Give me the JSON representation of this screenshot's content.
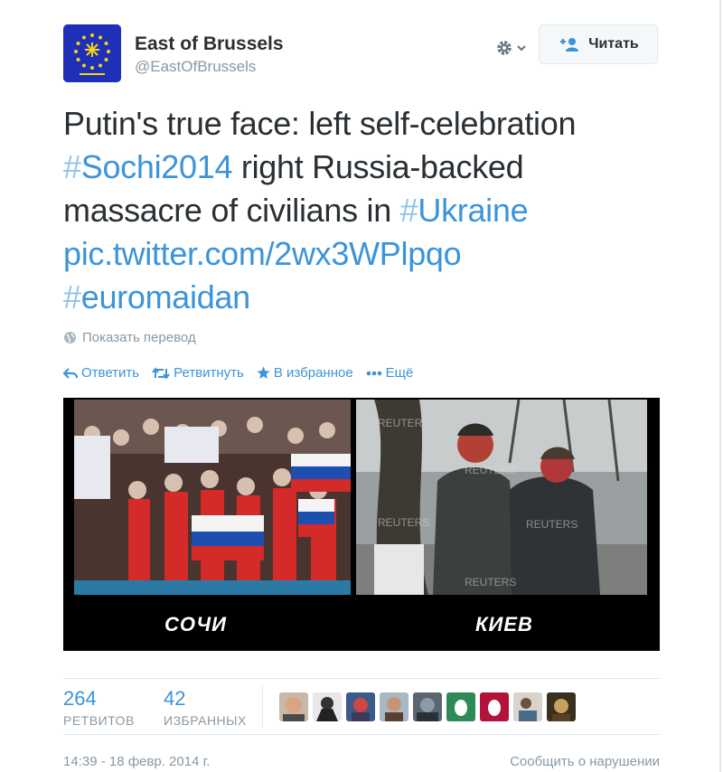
{
  "author": {
    "name": "East of Brussels",
    "handle": "@EastOfBrussels",
    "avatar_colors": {
      "bg": "#1e2fb8",
      "stars": "#f7d21a",
      "text": "#f7d21a"
    }
  },
  "follow_button": {
    "label": "Читать",
    "icon": "add-user-icon"
  },
  "gear_button": {
    "icon": "gear-icon"
  },
  "tweet": {
    "line1_text": "Putin's true face: left self-celebration",
    "line2_hash1": "Sochi2014",
    "line2_rest": " right Russia-backed",
    "line3_text": "massacre of civilians in ",
    "line3_hash": "Ukraine",
    "link": "pic.twitter.com/2wx3WPlpqo",
    "line5_hash": "euromaidan",
    "hash_symbol": "#"
  },
  "translate_label": "Показать перевод",
  "actions": {
    "reply": "Ответить",
    "retweet": "Ретвитнуть",
    "favorite": "В избранное",
    "more": "Ещё"
  },
  "media": {
    "left_caption": "СОЧИ",
    "right_caption": "КИЕВ",
    "watermark": "REUTERS"
  },
  "stats": {
    "retweets_count": "264",
    "retweets_label": "РЕТВИТОВ",
    "favorites_count": "42",
    "favorites_label": "ИЗБРАННЫХ"
  },
  "footer": {
    "timestamp": "14:39 - 18 февр. 2014 г.",
    "report": "Сообщить о нарушении"
  },
  "colors": {
    "link": "#3b94d9",
    "text": "#292f33",
    "muted": "#8899a6",
    "border": "#e1e8ed"
  }
}
